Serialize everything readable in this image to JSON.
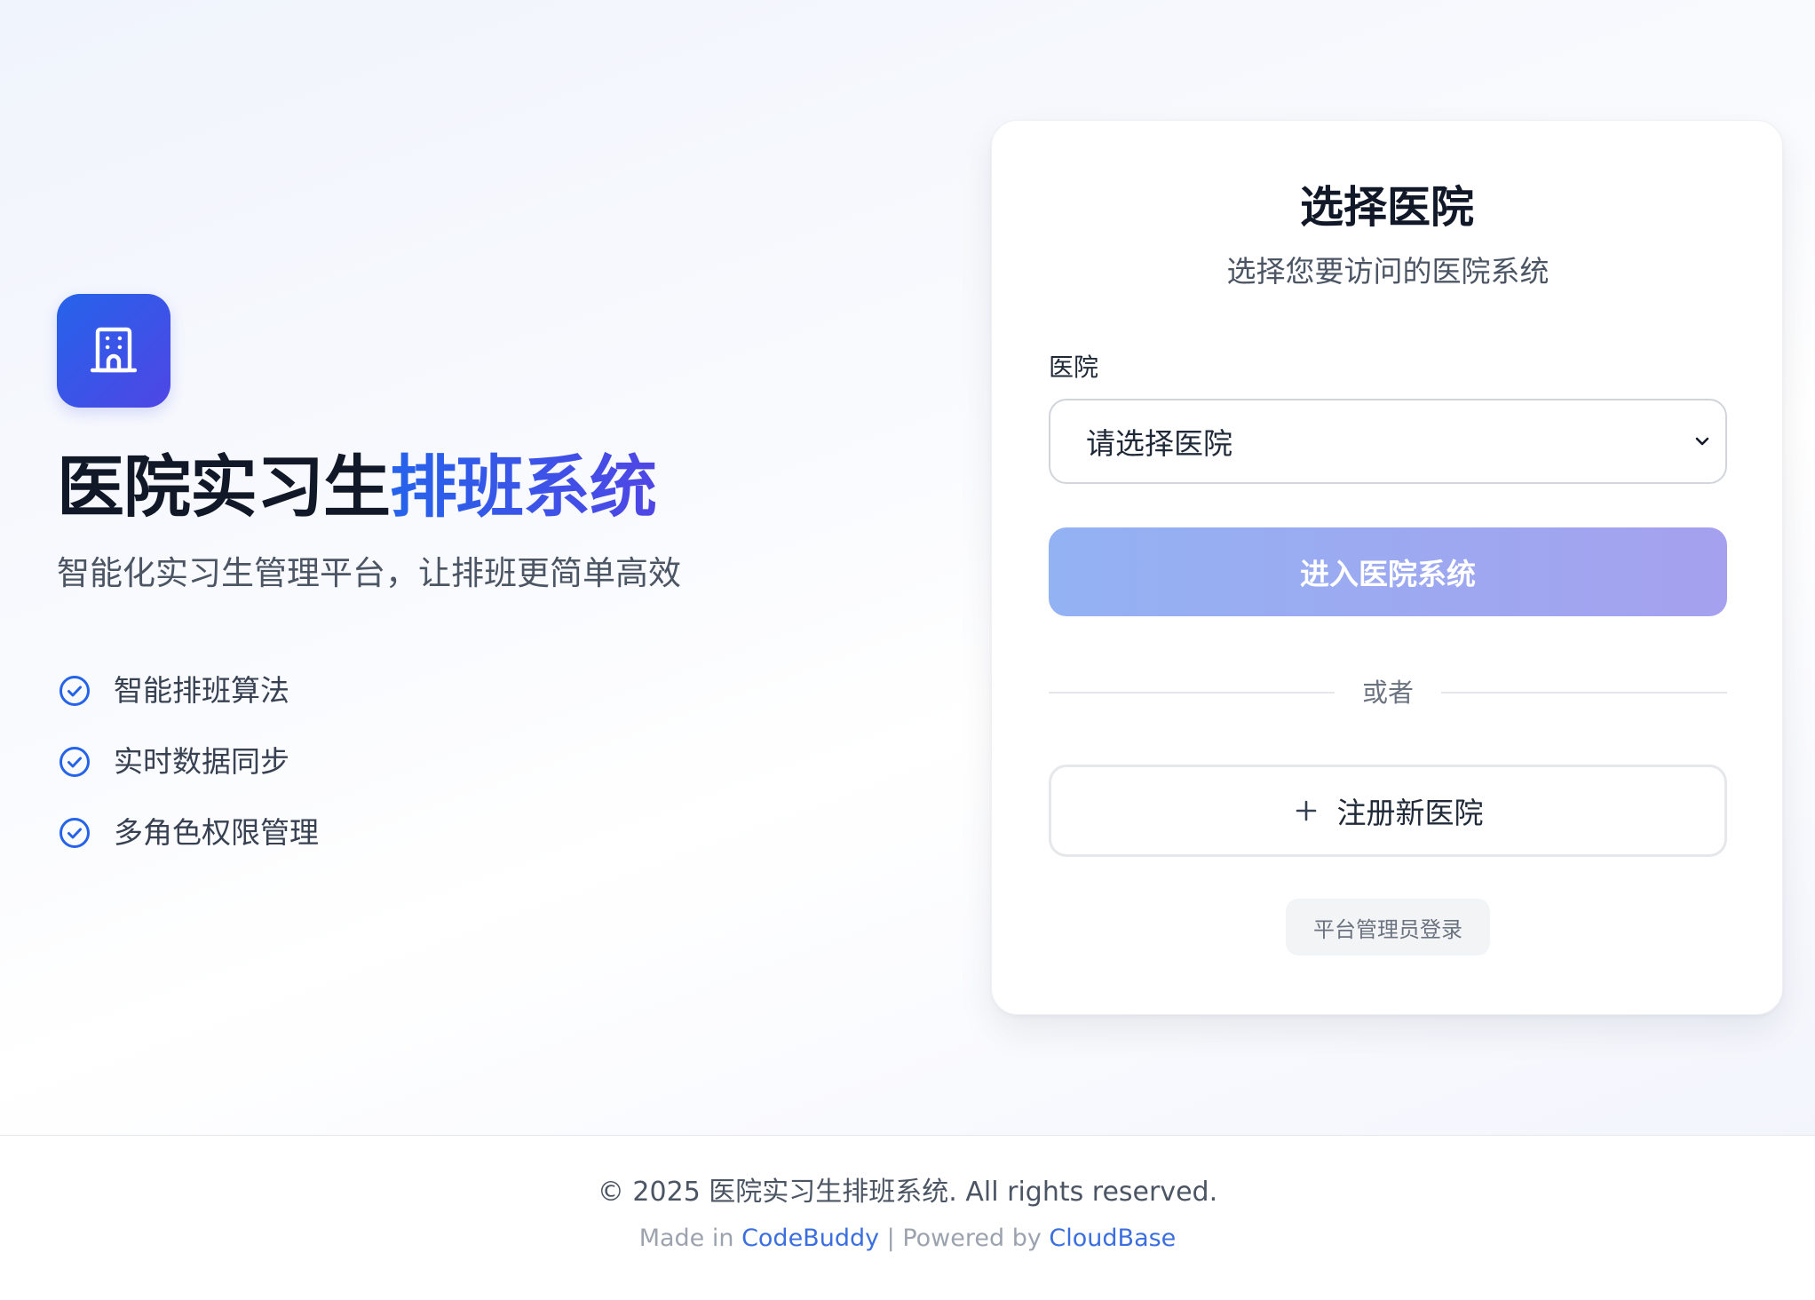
{
  "brand": {
    "title_main": "医院实习生",
    "title_accent": "排班系统",
    "tagline": "智能化实习生管理平台，让排班更简单高效",
    "logo_icon": "building-icon",
    "features": [
      {
        "icon": "check-circle-icon",
        "label": "智能排班算法"
      },
      {
        "icon": "check-circle-icon",
        "label": "实时数据同步"
      },
      {
        "icon": "check-circle-icon",
        "label": "多角色权限管理"
      }
    ]
  },
  "card": {
    "title": "选择医院",
    "subtitle": "选择您要访问的医院系统",
    "field_label": "医院",
    "select_value": "请选择医院",
    "enter_button": "进入医院系统",
    "divider_text": "或者",
    "register_button": "注册新医院",
    "admin_button": "平台管理员登录"
  },
  "footer": {
    "copyright": "© 2025 医院实习生排班系统. All rights reserved.",
    "made_in_prefix": "Made in ",
    "made_in_link": "CodeBuddy",
    "separator": " | Powered by ",
    "powered_link": "CloudBase"
  },
  "colors": {
    "accent": "#2563eb",
    "accent_secondary": "#4f46e5",
    "button_disabled_start": "#93b2f3",
    "button_disabled_end": "#a5a1ef"
  }
}
